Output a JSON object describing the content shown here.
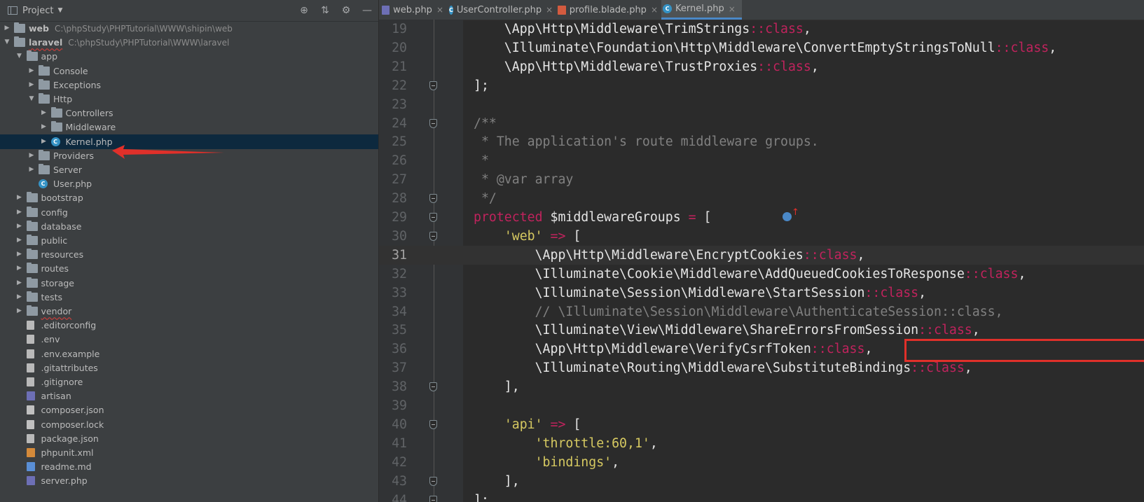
{
  "sidebar": {
    "title": "Project",
    "tree": [
      {
        "depth": 0,
        "expanded": false,
        "type": "folder",
        "name": "web",
        "path": "C:\\phpStudy\\PHPTutorial\\WWW\\shipin\\web",
        "bold": true
      },
      {
        "depth": 0,
        "expanded": true,
        "type": "folder",
        "name": "laravel",
        "path": "C:\\phpStudy\\PHPTutorial\\WWW\\laravel",
        "bold": true,
        "wavy": true
      },
      {
        "depth": 1,
        "expanded": true,
        "type": "folder",
        "name": "app"
      },
      {
        "depth": 2,
        "expanded": false,
        "type": "folder",
        "name": "Console"
      },
      {
        "depth": 2,
        "expanded": false,
        "type": "folder",
        "name": "Exceptions"
      },
      {
        "depth": 2,
        "expanded": true,
        "type": "folder",
        "name": "Http"
      },
      {
        "depth": 3,
        "expanded": false,
        "type": "folder",
        "name": "Controllers"
      },
      {
        "depth": 3,
        "expanded": false,
        "type": "folder",
        "name": "Middleware"
      },
      {
        "depth": 3,
        "expanded": false,
        "type": "phpclass",
        "name": "Kernel.php",
        "selected": true
      },
      {
        "depth": 2,
        "expanded": false,
        "type": "folder",
        "name": "Providers"
      },
      {
        "depth": 2,
        "expanded": false,
        "type": "folder",
        "name": "Server"
      },
      {
        "depth": 2,
        "leaf": true,
        "type": "phpclass",
        "name": "User.php"
      },
      {
        "depth": 1,
        "expanded": false,
        "type": "folder",
        "name": "bootstrap"
      },
      {
        "depth": 1,
        "expanded": false,
        "type": "folder",
        "name": "config"
      },
      {
        "depth": 1,
        "expanded": false,
        "type": "folder",
        "name": "database"
      },
      {
        "depth": 1,
        "expanded": false,
        "type": "folder",
        "name": "public"
      },
      {
        "depth": 1,
        "expanded": false,
        "type": "folder",
        "name": "resources"
      },
      {
        "depth": 1,
        "expanded": false,
        "type": "folder",
        "name": "routes"
      },
      {
        "depth": 1,
        "expanded": false,
        "type": "folder",
        "name": "storage"
      },
      {
        "depth": 1,
        "expanded": false,
        "type": "folder",
        "name": "tests"
      },
      {
        "depth": 1,
        "expanded": false,
        "type": "folder",
        "name": "vendor",
        "wavy": true
      },
      {
        "depth": 1,
        "leaf": true,
        "type": "generic",
        "name": ".editorconfig"
      },
      {
        "depth": 1,
        "leaf": true,
        "type": "generic",
        "name": ".env"
      },
      {
        "depth": 1,
        "leaf": true,
        "type": "generic",
        "name": ".env.example"
      },
      {
        "depth": 1,
        "leaf": true,
        "type": "generic",
        "name": ".gitattributes"
      },
      {
        "depth": 1,
        "leaf": true,
        "type": "generic",
        "name": ".gitignore"
      },
      {
        "depth": 1,
        "leaf": true,
        "type": "php",
        "name": "artisan"
      },
      {
        "depth": 1,
        "leaf": true,
        "type": "json",
        "name": "composer.json"
      },
      {
        "depth": 1,
        "leaf": true,
        "type": "json",
        "name": "composer.lock"
      },
      {
        "depth": 1,
        "leaf": true,
        "type": "generic",
        "name": "package.json"
      },
      {
        "depth": 1,
        "leaf": true,
        "type": "xml",
        "name": "phpunit.xml"
      },
      {
        "depth": 1,
        "leaf": true,
        "type": "md",
        "name": "readme.md"
      },
      {
        "depth": 1,
        "leaf": true,
        "type": "php",
        "name": "server.php"
      }
    ]
  },
  "tabs": [
    {
      "label": "web.php",
      "icon": "php-file-icon",
      "active": false
    },
    {
      "label": "UserController.php",
      "icon": "php-class-icon",
      "active": false
    },
    {
      "label": "profile.blade.php",
      "icon": "blade-file-icon",
      "active": false
    },
    {
      "label": "Kernel.php",
      "icon": "php-class-icon",
      "active": true
    }
  ],
  "code": [
    {
      "n": "19",
      "fold": false,
      "tokens": [
        [
          "pl",
          "    \\App\\Http\\Middleware\\TrimStrings"
        ],
        [
          "op",
          "::class"
        ],
        [
          "pl",
          ","
        ]
      ]
    },
    {
      "n": "20",
      "fold": false,
      "tokens": [
        [
          "pl",
          "    \\Illuminate\\Foundation\\Http\\Middleware\\ConvertEmptyStringsToNull"
        ],
        [
          "op",
          "::class"
        ],
        [
          "pl",
          ","
        ]
      ]
    },
    {
      "n": "21",
      "fold": false,
      "tokens": [
        [
          "pl",
          "    \\App\\Http\\Middleware\\TrustProxies"
        ],
        [
          "op",
          "::class"
        ],
        [
          "pl",
          ","
        ]
      ]
    },
    {
      "n": "22",
      "fold": true,
      "tokens": [
        [
          "pl",
          "];"
        ]
      ]
    },
    {
      "n": "23",
      "fold": false,
      "tokens": []
    },
    {
      "n": "24",
      "fold": true,
      "tokens": [
        [
          "cmt",
          "/**"
        ]
      ]
    },
    {
      "n": "25",
      "fold": false,
      "tokens": [
        [
          "cmt",
          " * The application's route middleware groups."
        ]
      ]
    },
    {
      "n": "26",
      "fold": false,
      "tokens": [
        [
          "cmt",
          " *"
        ]
      ]
    },
    {
      "n": "27",
      "fold": false,
      "tokens": [
        [
          "cmt",
          " * @var array"
        ]
      ]
    },
    {
      "n": "28",
      "fold": true,
      "tokens": [
        [
          "cmt",
          " */"
        ]
      ]
    },
    {
      "n": "29",
      "fold": true,
      "tokens": [
        [
          "pkw",
          "protected"
        ],
        [
          "pl",
          " $middlewareGroups "
        ],
        [
          "op",
          "="
        ],
        [
          "pl",
          " ["
        ]
      ]
    },
    {
      "n": "30",
      "fold": true,
      "tokens": [
        [
          "pl",
          "    "
        ],
        [
          "str",
          "'web'"
        ],
        [
          "pl",
          " "
        ],
        [
          "op",
          "=>"
        ],
        [
          "pl",
          " ["
        ]
      ]
    },
    {
      "n": "31",
      "fold": false,
      "current": true,
      "tokens": [
        [
          "pl",
          "        \\App\\Http\\Middleware\\EncryptCookies"
        ],
        [
          "op",
          "::class"
        ],
        [
          "pl",
          ","
        ]
      ]
    },
    {
      "n": "32",
      "fold": false,
      "tokens": [
        [
          "pl",
          "        \\Illuminate\\Cookie\\Middleware\\AddQueuedCookiesToResponse"
        ],
        [
          "op",
          "::class"
        ],
        [
          "pl",
          ","
        ]
      ]
    },
    {
      "n": "33",
      "fold": false,
      "tokens": [
        [
          "pl",
          "        \\Illuminate\\Session\\Middleware\\StartSession"
        ],
        [
          "op",
          "::class"
        ],
        [
          "pl",
          ","
        ]
      ]
    },
    {
      "n": "34",
      "fold": false,
      "tokens": [
        [
          "cmt",
          "        // \\Illuminate\\Session\\Middleware\\AuthenticateSession::class,"
        ]
      ]
    },
    {
      "n": "35",
      "fold": false,
      "tokens": [
        [
          "pl",
          "        \\Illuminate\\View\\Middleware\\ShareErrorsFromSession"
        ],
        [
          "op",
          "::class"
        ],
        [
          "pl",
          ","
        ]
      ]
    },
    {
      "n": "36",
      "fold": false,
      "tokens": [
        [
          "pl",
          "        \\App\\Http\\Middleware\\VerifyCsrfToken"
        ],
        [
          "op",
          "::class"
        ],
        [
          "pl",
          ","
        ]
      ]
    },
    {
      "n": "37",
      "fold": false,
      "tokens": [
        [
          "pl",
          "        \\Illuminate\\Routing\\Middleware\\SubstituteBindings"
        ],
        [
          "op",
          "::class"
        ],
        [
          "pl",
          ","
        ]
      ]
    },
    {
      "n": "38",
      "fold": true,
      "tokens": [
        [
          "pl",
          "    ],"
        ]
      ]
    },
    {
      "n": "39",
      "fold": false,
      "tokens": []
    },
    {
      "n": "40",
      "fold": true,
      "tokens": [
        [
          "pl",
          "    "
        ],
        [
          "str",
          "'api'"
        ],
        [
          "pl",
          " "
        ],
        [
          "op",
          "=>"
        ],
        [
          "pl",
          " ["
        ]
      ]
    },
    {
      "n": "41",
      "fold": false,
      "tokens": [
        [
          "pl",
          "        "
        ],
        [
          "str",
          "'throttle:60,1'"
        ],
        [
          "pl",
          ","
        ]
      ]
    },
    {
      "n": "42",
      "fold": false,
      "tokens": [
        [
          "pl",
          "        "
        ],
        [
          "str",
          "'bindings'"
        ],
        [
          "pl",
          ","
        ]
      ]
    },
    {
      "n": "43",
      "fold": true,
      "tokens": [
        [
          "pl",
          "    ],"
        ]
      ]
    },
    {
      "n": "44",
      "fold": true,
      "tokens": [
        [
          "pl",
          "];"
        ]
      ]
    }
  ],
  "colors": {
    "keyword": "#c1235d",
    "string": "#d6c961",
    "comment": "#808080",
    "highlight_box": "#e0302a",
    "selection": "#0d293e"
  }
}
